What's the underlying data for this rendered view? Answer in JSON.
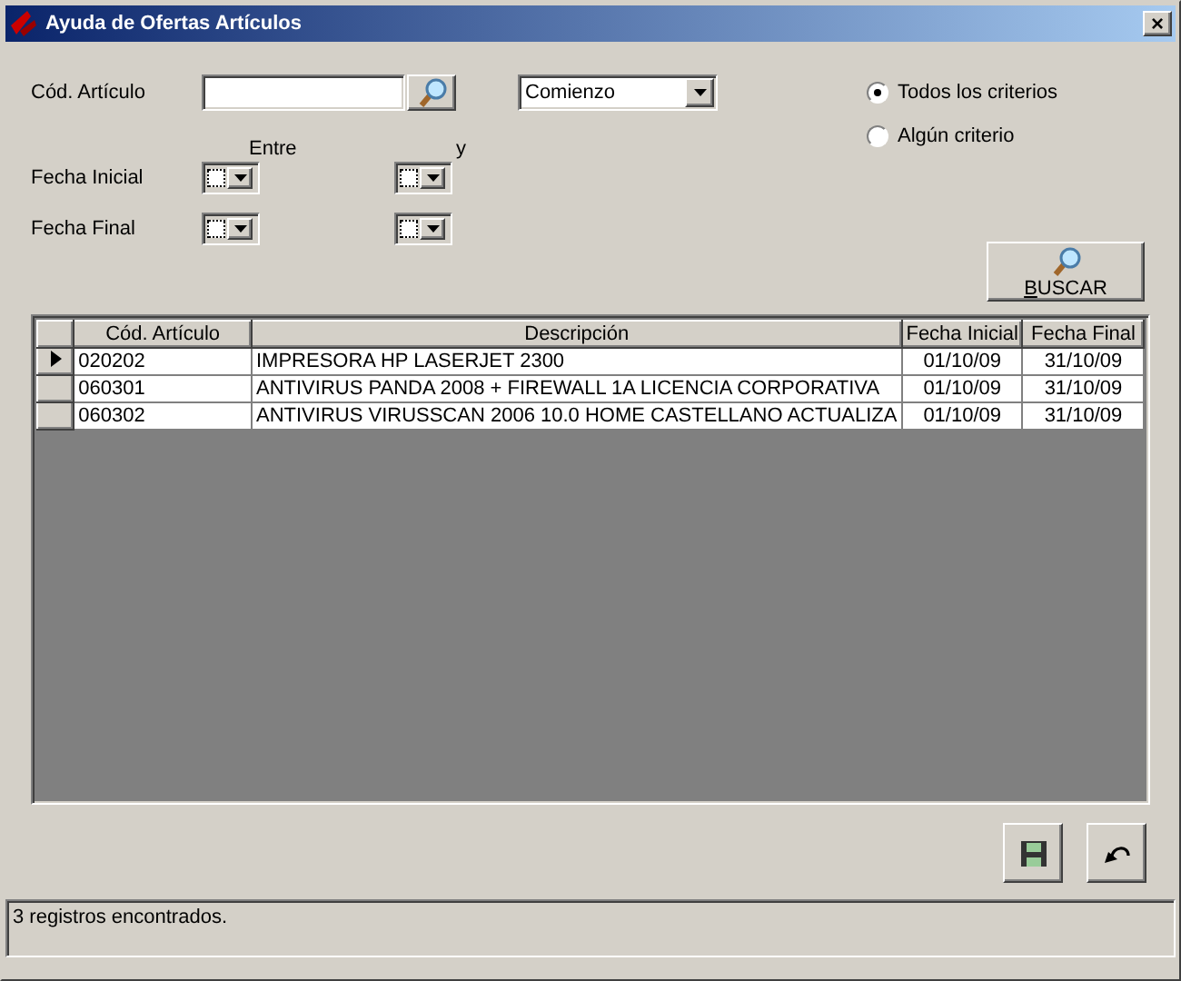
{
  "window": {
    "title": "Ayuda de Ofertas Artículos",
    "close": "×"
  },
  "code_field": {
    "label": "Cód. Artículo"
  },
  "match_combo": {
    "value": "Comienzo"
  },
  "criteria": [
    {
      "label": "Todos los criterios",
      "selected": true
    },
    {
      "label": "Algún criterio",
      "selected": false
    }
  ],
  "range_labels": {
    "from": "Entre",
    "to": "y"
  },
  "date_rows": [
    {
      "label": "Fecha Inicial",
      "from_checked": false,
      "to_checked": false
    },
    {
      "label": "Fecha Final",
      "from_checked": false,
      "to_checked": false
    }
  ],
  "search_button": {
    "label": "BUSCAR"
  },
  "table": {
    "columns": [
      "Cód. Artículo",
      "Descripción",
      "Fecha Inicial",
      "Fecha Final"
    ],
    "rows": [
      {
        "selected": true,
        "cells": [
          "020202",
          "IMPRESORA HP LASERJET 2300",
          "01/10/09",
          "31/10/09"
        ]
      },
      {
        "selected": false,
        "cells": [
          "060301",
          "ANTIVIRUS PANDA 2008 + FIREWALL 1A LICENCIA CORPORATIVA",
          "01/10/09",
          "31/10/09"
        ]
      },
      {
        "selected": false,
        "cells": [
          "060302",
          "ANTIVIRUS VIRUSSCAN 2006 10.0 HOME CASTELLANO ACTUALIZA",
          "01/10/09",
          "31/10/09"
        ]
      }
    ]
  },
  "status_bar": "3 registros encontrados."
}
